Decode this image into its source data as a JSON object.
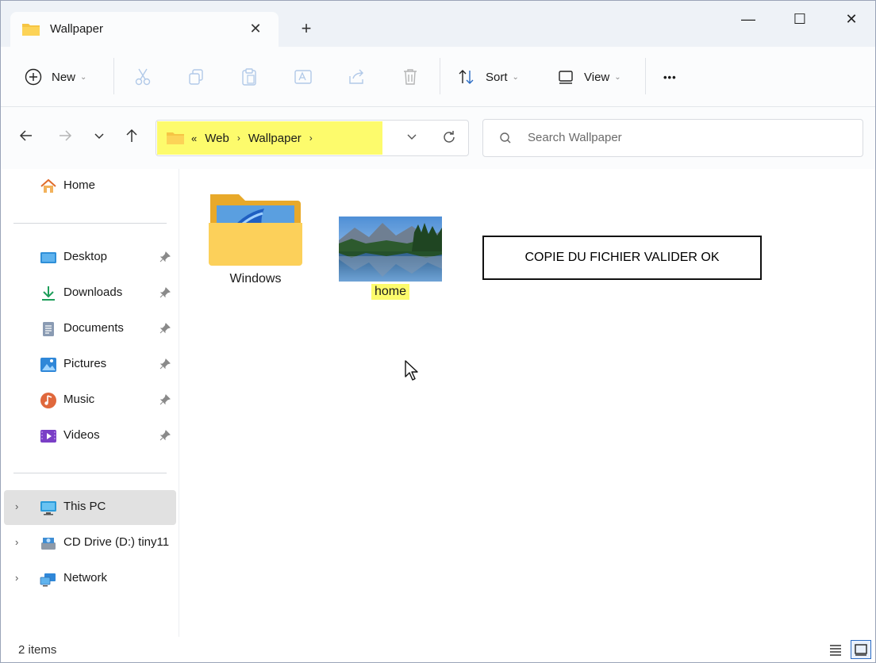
{
  "window": {
    "tab_title": "Wallpaper",
    "tab_close": "✕",
    "new_tab": "+",
    "minimize": "—",
    "maximize": "☐",
    "close": "✕"
  },
  "toolbar": {
    "new_label": "New",
    "sort_label": "Sort",
    "view_label": "View",
    "more_label": "•••"
  },
  "address": {
    "overflow": "«",
    "crumbs": [
      "Web",
      "Wallpaper"
    ],
    "search_placeholder": "Search Wallpaper"
  },
  "sidebar": {
    "home": "Home",
    "quick_access": [
      {
        "label": "Desktop",
        "icon": "desktop-icon"
      },
      {
        "label": "Downloads",
        "icon": "downloads-icon"
      },
      {
        "label": "Documents",
        "icon": "documents-icon"
      },
      {
        "label": "Pictures",
        "icon": "pictures-icon"
      },
      {
        "label": "Music",
        "icon": "music-icon"
      },
      {
        "label": "Videos",
        "icon": "videos-icon"
      }
    ],
    "this_pc": "This PC",
    "cd_drive": "CD Drive (D:) tiny11",
    "network": "Network"
  },
  "content": {
    "items": [
      {
        "name": "Windows",
        "type": "folder"
      },
      {
        "name": "home",
        "type": "image"
      }
    ],
    "notice": "COPIE DU FICHIER VALIDER OK"
  },
  "status": {
    "count": "2 items"
  },
  "colors": {
    "highlight": "#fdfb6c",
    "folder": "#f6c544",
    "accent": "#2b6cc4"
  }
}
